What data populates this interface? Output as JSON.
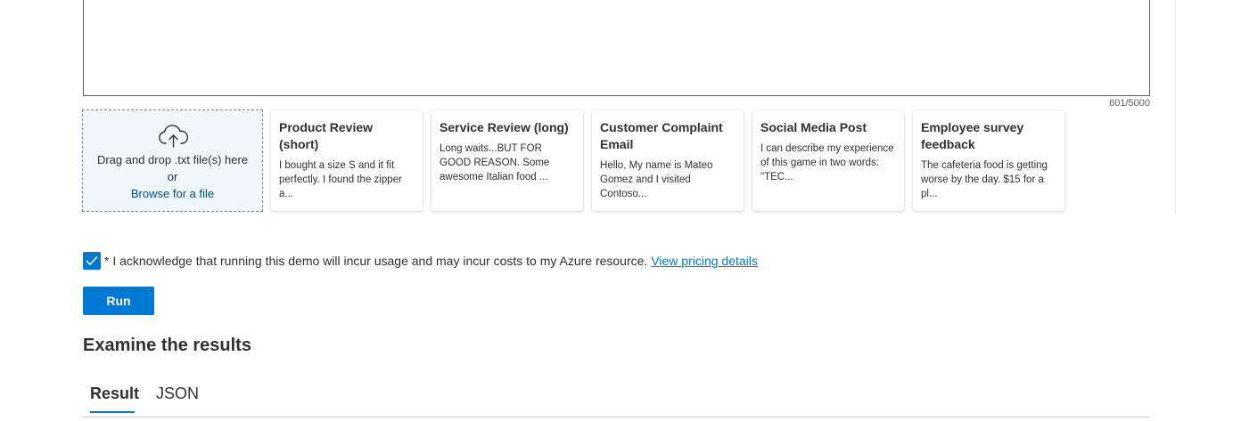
{
  "input": {
    "char_count": "601/5000"
  },
  "upload": {
    "icon": "cloud-upload-icon",
    "drag_text": "Drag and drop .txt file(s) here",
    "or_text": "or",
    "browse_label": "Browse for a file"
  },
  "samples": [
    {
      "title": "Product Review (short)",
      "preview": "I bought a size S and it fit perfectly. I found the zipper a..."
    },
    {
      "title": "Service Review (long)",
      "preview": "Long waits...BUT FOR GOOD REASON. Some awesome Italian food ..."
    },
    {
      "title": "Customer Complaint Email",
      "preview": "Hello, My name is Mateo Gomez and I visited Contoso..."
    },
    {
      "title": "Social Media Post",
      "preview": "I can describe my experience of this game in two words: \"TEC..."
    },
    {
      "title": "Employee survey feedback",
      "preview": "The cafeteria food is getting worse by the day. $15 for a pl..."
    }
  ],
  "acknowledge": {
    "checked": true,
    "text": "* I acknowledge that running this demo will incur usage and may incur costs to my Azure resource.",
    "link_label": "View pricing details"
  },
  "run_label": "Run",
  "results": {
    "heading": "Examine the results",
    "tabs": [
      "Result",
      "JSON"
    ],
    "active_tab": "Result"
  },
  "colors": {
    "accent": "#0078d4",
    "link": "#004e8c",
    "dropzone_bg": "#eff6fc",
    "text": "#323130"
  }
}
